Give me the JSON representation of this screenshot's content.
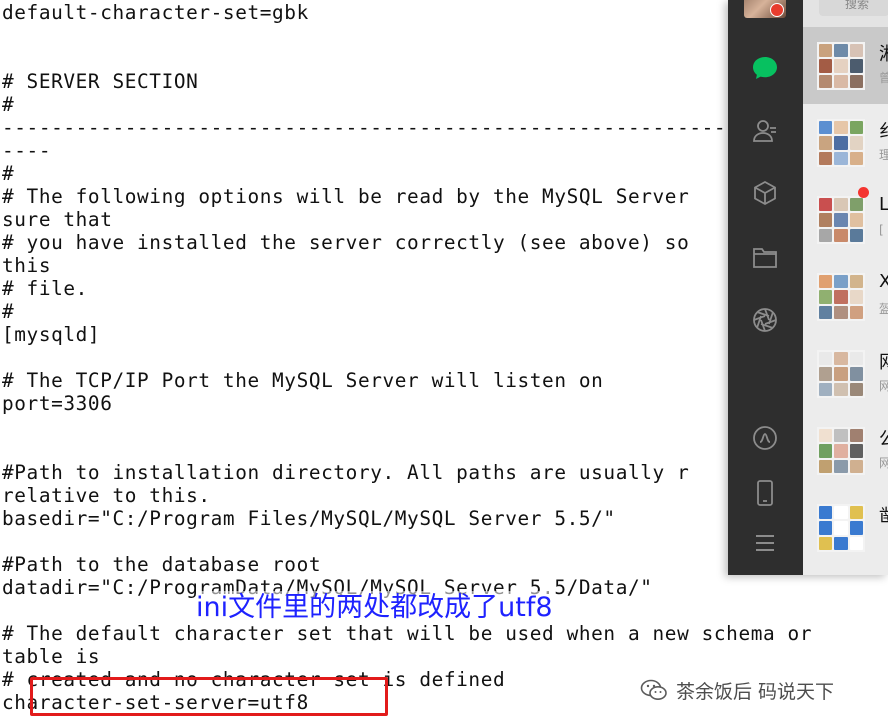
{
  "editor": {
    "lines": [
      "default-character-set=gbk",
      "",
      "",
      "# SERVER SECTION",
      "#",
      "-------------------------------------------------------------",
      "----",
      "#",
      "# The following options will be read by the MySQL Server",
      "sure that",
      "# you have installed the server correctly (see above) so",
      "this",
      "# file.",
      "#",
      "[mysqld]",
      "",
      "# The TCP/IP Port the MySQL Server will listen on",
      "port=3306",
      "",
      "",
      "#Path to installation directory. All paths are usually r",
      "relative to this.",
      "basedir=\"C:/Program Files/MySQL/MySQL Server 5.5/\"",
      "",
      "#Path to the database root",
      "datadir=\"C:/ProgramData/MySQL/MySQL Server 5.5/Data/\"",
      "",
      "# The default character set that will be used when a new schema or",
      "table is",
      "# created and no character set is defined",
      "character-set-server=utf8"
    ]
  },
  "annotation": {
    "text": "ini文件里的两处都改成了utf8",
    "text_color": "#1e22ff",
    "box_color": "#e21b1b"
  },
  "watermark": {
    "text": "茶余饭后 码说天下",
    "icon": "wechat-icon"
  },
  "wechat": {
    "search_placeholder": "搜索",
    "sidebar_icons": [
      "chat-icon",
      "contacts-icon",
      "favorites-icon",
      "files-icon",
      "moments-icon",
      "channels-icon",
      "phone-icon",
      "menu-icon"
    ],
    "chats": [
      {
        "name": "湘",
        "preview": "曾"
      },
      {
        "name": "纟",
        "preview": "理"
      },
      {
        "name": "L",
        "preview": "["
      },
      {
        "name": "X",
        "preview": "盔"
      },
      {
        "name": "网",
        "preview": "网"
      },
      {
        "name": "公",
        "preview": "网"
      },
      {
        "name": "凿",
        "preview": ""
      }
    ],
    "colors": {
      "sidebar": "#2e2e2e",
      "active": "#07c160",
      "list_bg": "#ececec"
    }
  }
}
